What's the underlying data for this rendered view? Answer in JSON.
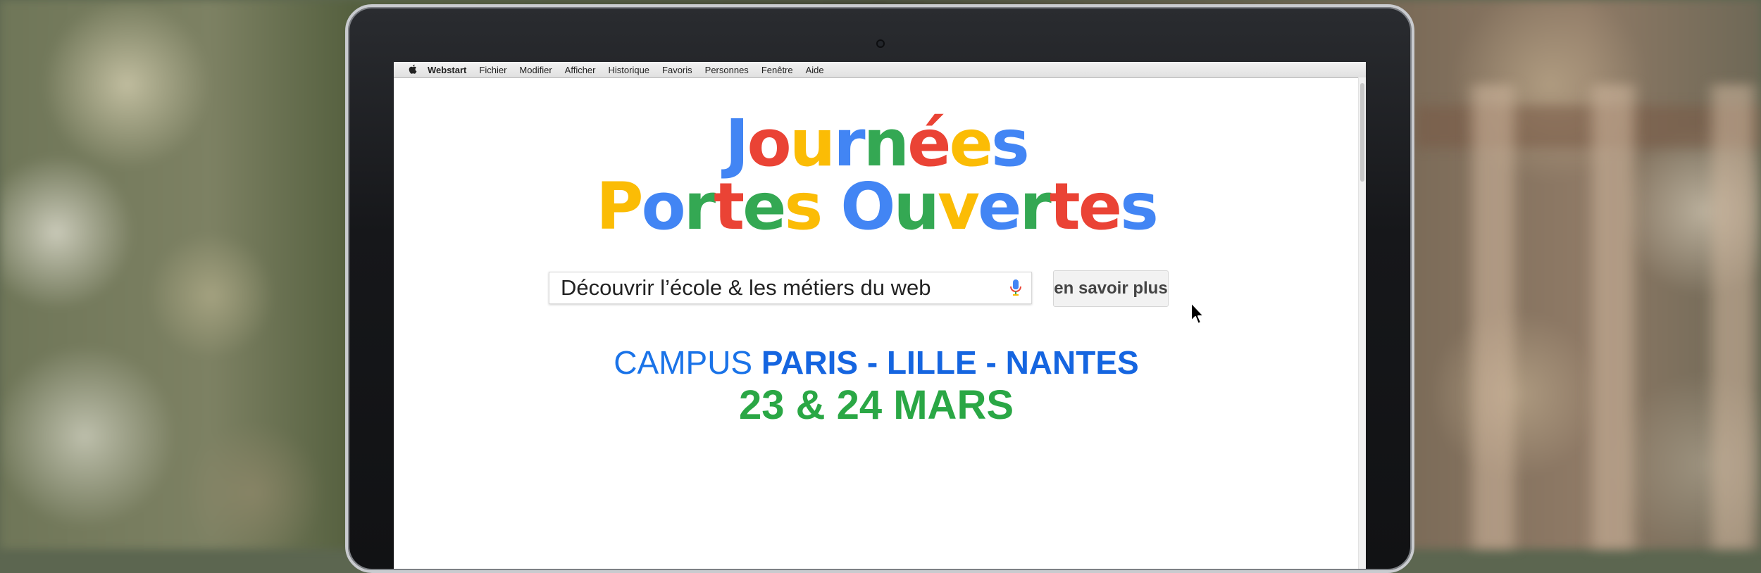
{
  "colors": {
    "blue": "#4285F4",
    "red": "#EA4335",
    "yellow": "#FBBC05",
    "green": "#34A853",
    "campus_blue": "#1a73e8",
    "dates_green": "#2aa745"
  },
  "menubar": {
    "apple_icon": "apple-logo-icon",
    "app_name": "Webstart",
    "items": [
      "Fichier",
      "Modifier",
      "Afficher",
      "Historique",
      "Favoris",
      "Personnes",
      "Fenêtre",
      "Aide"
    ]
  },
  "headline": {
    "line1": [
      {
        "text": "J",
        "color": "blue"
      },
      {
        "text": "o",
        "color": "red"
      },
      {
        "text": "u",
        "color": "yellow"
      },
      {
        "text": "r",
        "color": "blue"
      },
      {
        "text": "n",
        "color": "green"
      },
      {
        "text": "é",
        "color": "red"
      },
      {
        "text": "e",
        "color": "yellow"
      },
      {
        "text": "s",
        "color": "blue"
      }
    ],
    "line2": [
      {
        "text": "P",
        "color": "yellow"
      },
      {
        "text": "o",
        "color": "blue"
      },
      {
        "text": "r",
        "color": "green"
      },
      {
        "text": "t",
        "color": "red"
      },
      {
        "text": "e",
        "color": "green"
      },
      {
        "text": "s",
        "color": "yellow"
      },
      {
        "text": " ",
        "color": "blue"
      },
      {
        "text": "O",
        "color": "blue"
      },
      {
        "text": "u",
        "color": "green"
      },
      {
        "text": "v",
        "color": "yellow"
      },
      {
        "text": "e",
        "color": "blue"
      },
      {
        "text": "r",
        "color": "green"
      },
      {
        "text": "t",
        "color": "red"
      },
      {
        "text": "e",
        "color": "red"
      },
      {
        "text": "s",
        "color": "blue"
      }
    ]
  },
  "search": {
    "value": "Découvrir l’école & les métiers du web",
    "mic_icon": "microphone-icon"
  },
  "button": {
    "label": "en savoir plus"
  },
  "campus": {
    "prefix": "CAMPUS ",
    "cities": "PARIS - LILLE - NANTES"
  },
  "dates": "23 & 24 MARS"
}
